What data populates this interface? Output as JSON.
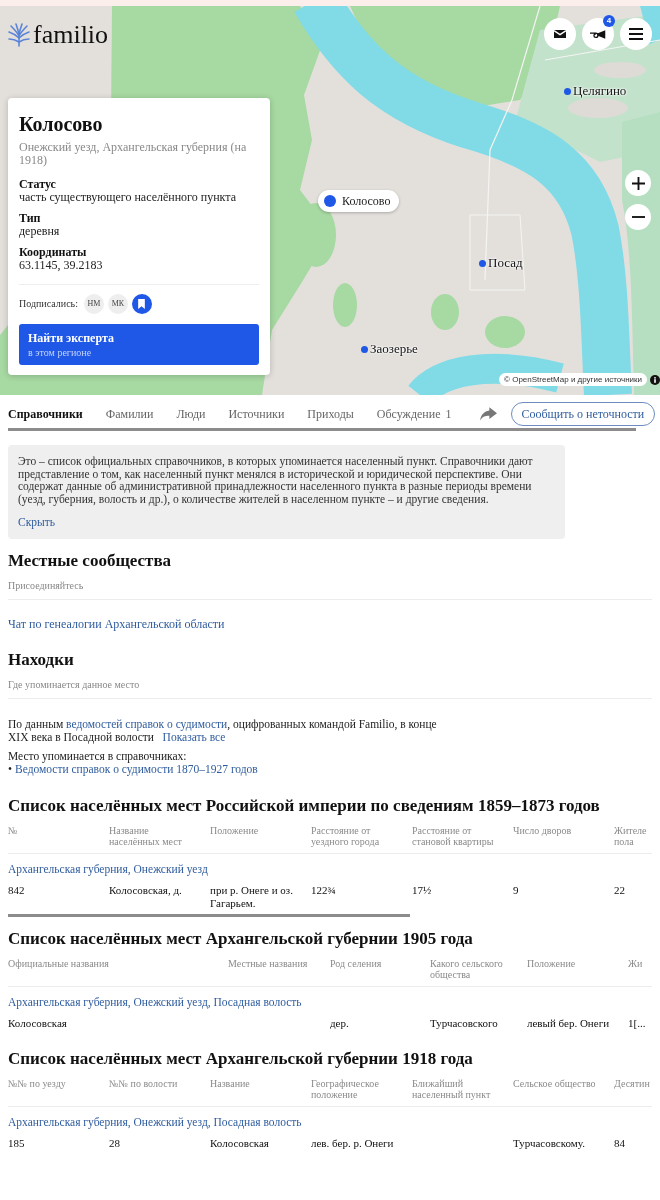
{
  "header": {
    "logo": "familio",
    "notification_count": "4"
  },
  "map": {
    "markers": [
      {
        "kind": "dot",
        "label": "Целягино"
      },
      {
        "kind": "current",
        "label": "Колосово"
      },
      {
        "kind": "dot",
        "label": "Посад"
      },
      {
        "kind": "dot",
        "label": "Заозерье"
      }
    ],
    "attribution": "© OpenStreetMap и другие источники"
  },
  "place_card": {
    "title": "Колосово",
    "subtitle": "Онежский уезд, Архангельская губерния (на 1918)",
    "fields": [
      {
        "label": "Статус",
        "value": "часть существующего населённого пункта"
      },
      {
        "label": "Тип",
        "value": "деревня"
      },
      {
        "label": "Координаты",
        "value": "63.1145, 39.2183"
      }
    ],
    "subscribers_label": "Подписались:",
    "subscribers": [
      "НМ",
      "МК"
    ],
    "expert_button": {
      "title": "Найти эксперта",
      "subtitle": "в этом регионе"
    }
  },
  "tabs": [
    {
      "label": "Справочники",
      "selected": true
    },
    {
      "label": "Фамилии",
      "selected": false
    },
    {
      "label": "Люди",
      "selected": false
    },
    {
      "label": "Источники",
      "selected": false
    },
    {
      "label": "Приходы",
      "selected": false
    },
    {
      "label": "Обсуждение",
      "count": "1",
      "selected": false
    }
  ],
  "report_button": "Сообщить о неточности",
  "info_box": {
    "text": "Это – список официальных справочников, в которых упоминается населенный пункт. Справочники дают представление о том, как населенный пункт менялся в исторической и юридической перспективе. Они содержат данные об административной принадлежности населенного пункта в разные периоды времени (уезд, губерния, волость и др.), о количестве жителей в населенном пункте – и другие сведения.",
    "hide_link": "Скрыть"
  },
  "communities": {
    "title": "Местные сообщества",
    "subtitle": "Присоединяйтесь",
    "links": [
      "Чат по генеалогии Архангельской области"
    ]
  },
  "findings": {
    "title": "Находки",
    "subtitle": "Где упоминается данное место",
    "summary": {
      "before": "По данным ",
      "link": "ведомостей справок о судимости",
      "after": ", оцифрованных командой Familio, в конце XIX века в Посадной волости",
      "show_all": "Показать все"
    },
    "mentions_label": "Место упоминается в справочниках:",
    "mentions": [
      {
        "bullet": "•",
        "title": "Ведомости справок о судимости 1870–1927 годов"
      }
    ]
  },
  "tables": [
    {
      "title": "Список населённых мест Российской империи по сведениям 1859–1873 годов",
      "columns": [
        "№",
        "Название населённых мест",
        "Положение",
        "Расстояние от уездного города",
        "Расстояние от становой квартиры",
        "Число дворов",
        "Жителе пола"
      ],
      "groups": [
        {
          "title": "Архангельская губерния, Онежский уезд",
          "rows": [
            [
              "842",
              "Колосовская, д.",
              "при р. Онеге и оз. Гагарьем.",
              "122¾",
              "17½",
              "9",
              "22"
            ]
          ]
        }
      ],
      "scrollbar": true
    },
    {
      "title": "Список населённых мест Архангельской губернии 1905 года",
      "columns": [
        "Официальные названия",
        "Местные названия",
        "Род селения",
        "Какого сельского общества",
        "Положение",
        "Жи"
      ],
      "groups": [
        {
          "title": "Архангельская губерния, Онежский уезд, Посадная волость",
          "rows": [
            [
              "Колосовская",
              null,
              "дер.",
              "Турчасовского",
              "левый бер. Онеги",
              "1[..."
            ]
          ]
        }
      ],
      "scrollbar": false
    },
    {
      "title": "Список населённых мест Архангельской губернии 1918 года",
      "columns": [
        "№№ по уезду",
        "№№ по волости",
        "Название",
        "Географическое положение",
        "Ближайший населенный пункт",
        "Сельское общество",
        "Десятин"
      ],
      "groups": [
        {
          "title": "Архангельская губерния, Онежский уезд, Посадная волость",
          "rows": [
            [
              "185",
              "28",
              "Колосовская",
              "лев. бер. р. Онеги",
              null,
              "Турчасовскому.",
              "84"
            ]
          ]
        }
      ],
      "scrollbar": false
    }
  ]
}
